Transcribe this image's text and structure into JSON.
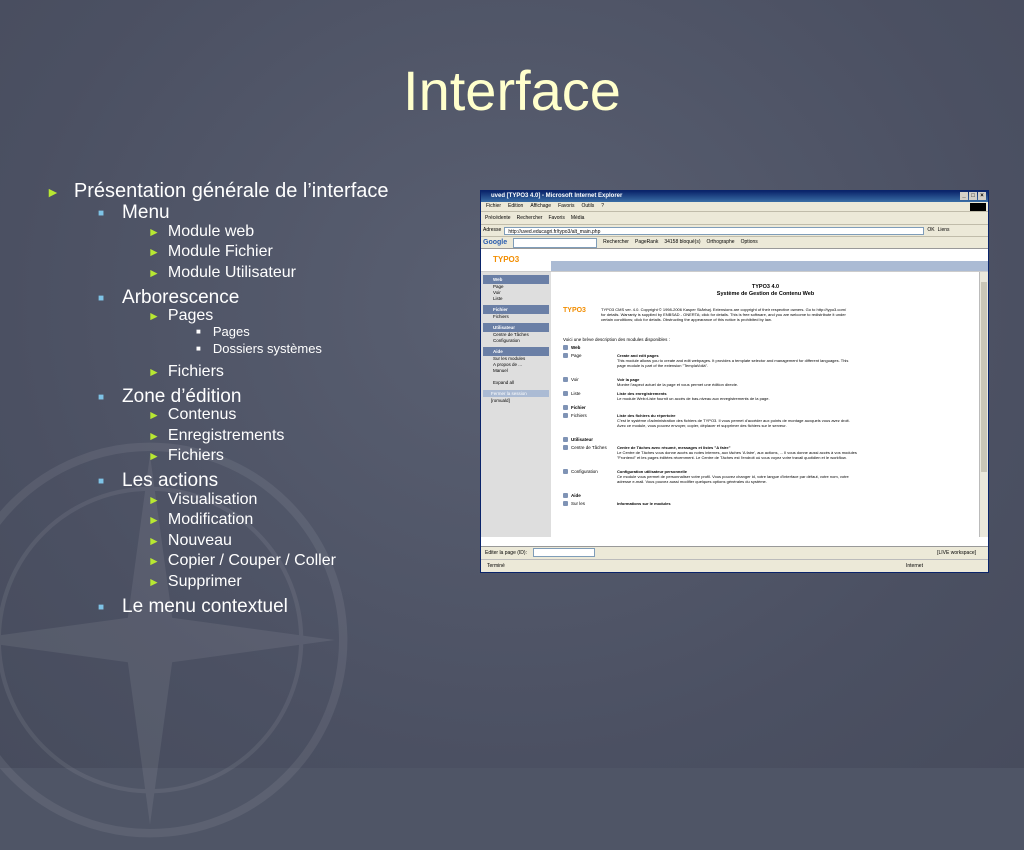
{
  "slide": {
    "title": "Interface",
    "outline": [
      {
        "level": 1,
        "text": "Présentation générale de l’interface"
      },
      {
        "level": 2,
        "text": "Menu"
      },
      {
        "level": 3,
        "text": "Module web"
      },
      {
        "level": 3,
        "text": "Module Fichier"
      },
      {
        "level": 3,
        "text": "Module Utilisateur"
      },
      {
        "level": 2,
        "text": "Arborescence"
      },
      {
        "level": 3,
        "text": "Pages"
      },
      {
        "level": 4,
        "text": "Pages"
      },
      {
        "level": 4,
        "text": "Dossiers systèmes"
      },
      {
        "level": 3,
        "text": "Fichiers"
      },
      {
        "level": 2,
        "text": "Zone d’édition"
      },
      {
        "level": 3,
        "text": "Contenus"
      },
      {
        "level": 3,
        "text": "Enregistrements"
      },
      {
        "level": 3,
        "text": "Fichiers"
      },
      {
        "level": 2,
        "text": "Les actions"
      },
      {
        "level": 3,
        "text": "Visualisation"
      },
      {
        "level": 3,
        "text": "Modification"
      },
      {
        "level": 3,
        "text": "Nouveau"
      },
      {
        "level": 3,
        "text": "Copier / Couper / Coller"
      },
      {
        "level": 3,
        "text": "Supprimer"
      },
      {
        "level": 2,
        "text": "Le menu contextuel"
      }
    ]
  },
  "browser": {
    "title": "uved [TYPO3 4.0] - Microsoft Internet Explorer",
    "menu": [
      "Fichier",
      "Edition",
      "Affichage",
      "Favoris",
      "Outils",
      "?"
    ],
    "toolbar": [
      "Précédente",
      "Rechercher",
      "Favoris",
      "Média"
    ],
    "address_label": "Adresse",
    "address": "http://uved.educagri.fr/typo3/alt_main.php",
    "go_label": "OK",
    "links_label": "Liens",
    "google_bar": [
      "Google",
      "Rechercher",
      "PageRank",
      "34158 bloqué(s)",
      "Orthographe",
      "Options"
    ],
    "status": "Terminé",
    "zone": "Internet"
  },
  "typo3": {
    "logo": "TYPO3",
    "sidebar": [
      {
        "group": "Web",
        "items": [
          "Page",
          "Voir",
          "Liste"
        ]
      },
      {
        "group": "Fichier",
        "items": [
          "Fichiers"
        ]
      },
      {
        "group": "Utilisateur",
        "items": [
          "Centre de Tâches",
          "Configuration"
        ]
      },
      {
        "group": "Aide",
        "items": [
          "Sur les modules",
          "A propos de ...",
          "Manuel"
        ]
      }
    ],
    "expand": "Expand all",
    "finish_session": "Fermer la session",
    "user": "[romuald]",
    "heading1": "TYPO3 4.0",
    "heading2": "Système de Gestion de Contenu Web",
    "copyright": "TYPO3 CMS ver. 4.0. Copyright © 1998-2006 Kasper Skårhøj. Extensions are copyright of their respective owners. Go to http://typo3.com/ for details. Warranty is supplied by ENBSAD - ONERTA; click for details. This is free software, and you are welcome to redistribute it under certain conditions; click for details. Obstructing the appearance of this notice is prohibited by law.",
    "intro": "Voici une brève description des modules disponibles :",
    "modules": [
      {
        "name": "Web",
        "section": true,
        "title": "",
        "desc": ""
      },
      {
        "name": "Page",
        "section": false,
        "title": "Create and edit pages",
        "desc": "This module allows you to create and edit webpages. It provides a template selector and management for different languages. This page module is part of the extension \"TemplaVoilà\"."
      },
      {
        "name": "Voir",
        "section": false,
        "title": "Voir la page",
        "desc": "Montre l'aspect actuel de la page et vous permet une édition directe."
      },
      {
        "name": "Liste",
        "section": false,
        "title": "Liste des enregistrements",
        "desc": "Le module Web>Liste fournit un accès de bas-niveau aux enregistrements de la page."
      },
      {
        "name": "Fichier",
        "section": true,
        "title": "",
        "desc": ""
      },
      {
        "name": "Fichiers",
        "section": false,
        "title": "Liste des fichiers du répertoire",
        "desc": "C'est le système d'administration des fichiers de TYPO3. Il vous permet d'accéder aux points de montage auxquels vous avez droit. Avec ce module, vous pouvez envoyer, copier, déplacer et supprimer des fichiers sur le serveur."
      },
      {
        "name": "Utilisateur",
        "section": true,
        "title": "",
        "desc": ""
      },
      {
        "name": "Centre de Tâches",
        "section": false,
        "title": "Centre de Tâches avec résumé, messages et listes \"A faire\"",
        "desc": "Le Centre de Tâches vous donne accès au notes internes, aux tâches 'A faire', aux actions, ... Il vous donne aussi accès à vos modules \"Frontend\" et les pages éditées récemment. Le Centre de Tâches est l'endroit où vous voyez votre travail quotidien et le workflow."
      },
      {
        "name": "Configuration",
        "section": false,
        "title": "Configuration utilisateur personnelle",
        "desc": "Ce module vous permet de personnaliser votre profil. Vous pouvez changer id, votre langue d'interface par défaut, votre nom, votre adresse e-mail. Vous pouvez aussi modifier quelques options générales du système."
      },
      {
        "name": "Aide",
        "section": true,
        "title": "",
        "desc": ""
      },
      {
        "name": "Sur les",
        "section": false,
        "title": "Informations sur le modules",
        "desc": ""
      }
    ],
    "edit_page_label": "Editer la page (ID):",
    "workspace": "[LIVE workspace]"
  }
}
